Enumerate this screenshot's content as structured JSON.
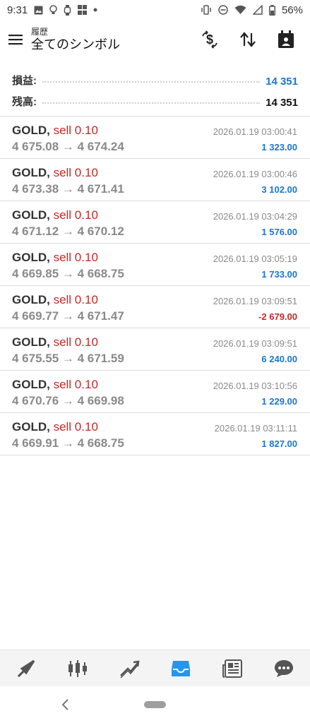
{
  "status_bar": {
    "time": "9:31",
    "battery": "56%"
  },
  "header": {
    "subtitle": "履歴",
    "title": "全てのシンボル"
  },
  "summary": {
    "pnl_label": "損益:",
    "pnl_value": "14 351",
    "balance_label": "残高:",
    "balance_value": "14 351"
  },
  "colors": {
    "profit": "#1976d2",
    "loss": "#c62828",
    "accent": "#2196f3"
  },
  "deals": [
    {
      "symbol": "GOLD,",
      "side": "sell 0.10",
      "time": "2026.01.19 03:00:41",
      "prices": "4 675.08 → 4 674.24",
      "profit": "1 323.00"
    },
    {
      "symbol": "GOLD,",
      "side": "sell 0.10",
      "time": "2026.01.19 03:00:46",
      "prices": "4 673.38 → 4 671.41",
      "profit": "3 102.00"
    },
    {
      "symbol": "GOLD,",
      "side": "sell 0.10",
      "time": "2026.01.19 03:04:29",
      "prices": "4 671.12 → 4 670.12",
      "profit": "1 576.00"
    },
    {
      "symbol": "GOLD,",
      "side": "sell 0.10",
      "time": "2026.01.19 03:05:19",
      "prices": "4 669.85 → 4 668.75",
      "profit": "1 733.00"
    },
    {
      "symbol": "GOLD,",
      "side": "sell 0.10",
      "time": "2026.01.19 03:09:51",
      "prices": "4 669.77 → 4 671.47",
      "profit": "-2 679.00"
    },
    {
      "symbol": "GOLD,",
      "side": "sell 0.10",
      "time": "2026.01.19 03:09:51",
      "prices": "4 675.55 → 4 671.59",
      "profit": "6 240.00"
    },
    {
      "symbol": "GOLD,",
      "side": "sell 0.10",
      "time": "2026.01.19 03:10:56",
      "prices": "4 670.76 → 4 669.98",
      "profit": "1 229.00"
    },
    {
      "symbol": "GOLD,",
      "side": "sell 0.10",
      "time": "2026.01.19 03:11:11",
      "prices": "4 669.91 → 4 668.75",
      "profit": "1 827.00"
    }
  ],
  "icons": {
    "menu": "hamburger-menu-icon",
    "currency": "currency-exchange-icon",
    "sort": "sort-arrows-icon",
    "calendar": "calendar-icon",
    "nav": [
      "quotes-icon",
      "chart-candles-icon",
      "trade-icon",
      "history-inbox-icon",
      "news-icon",
      "chat-icon"
    ],
    "nav_active_index": 3
  }
}
